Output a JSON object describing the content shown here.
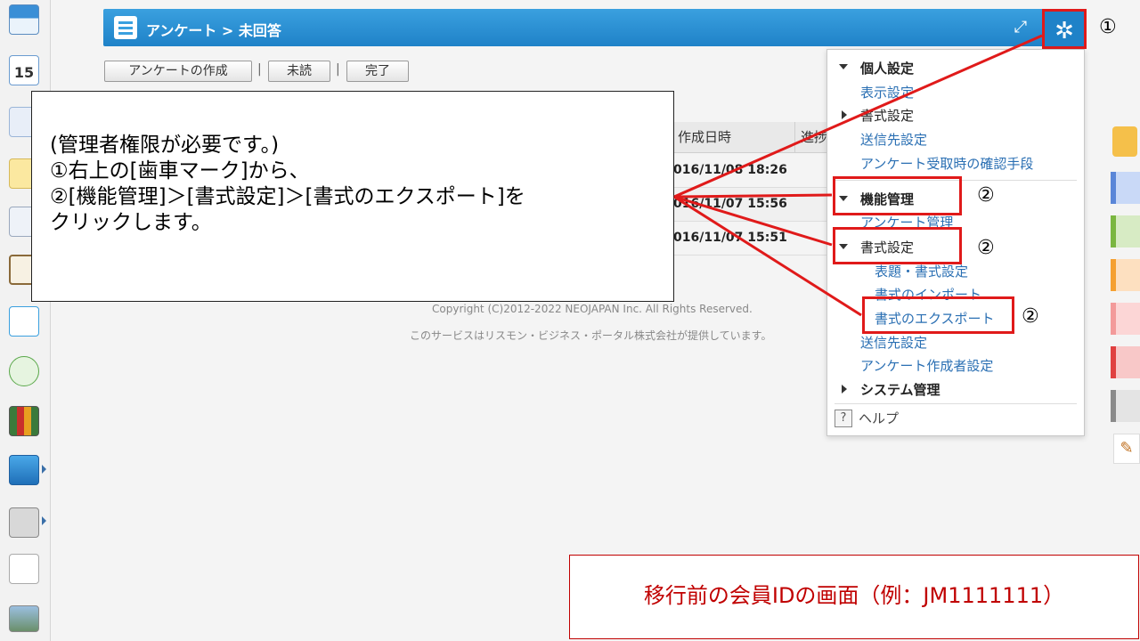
{
  "header": {
    "title": "アンケート > 未回答",
    "expand_icon": "expand-icon",
    "settings_icon": "gear-icon"
  },
  "toolbar": {
    "create_label": "アンケートの作成",
    "unread_label": "未読",
    "done_label": "完了",
    "separator": "|"
  },
  "table": {
    "columns": [
      "作成日時",
      "進捗"
    ],
    "rows": [
      "016/11/08 18:26",
      "016/11/07 15:56",
      "016/11/07 15:51"
    ]
  },
  "instruction": {
    "line1": "(管理者権限が必要です。)",
    "line2": "①右上の[歯車マーク]から、",
    "line3": "②[機能管理]＞[書式設定]＞[書式のエクスポート]を",
    "line4": "クリックします。"
  },
  "footer": {
    "copyright": "Copyright (C)2012-2022 NEOJAPAN Inc. All Rights Reserved.",
    "provider": "このサービスはリスモン・ビジネス・ポータル株式会社が提供しています。"
  },
  "menu": {
    "personal": "個人設定",
    "display": "表示設定",
    "format": "書式設定",
    "send_dest": "送信先設定",
    "receipt": "アンケート受取時の確認手段",
    "function_mgmt": "機能管理",
    "survey_mgmt": "アンケート管理",
    "format_settings": "書式設定",
    "title_format": "表題・書式設定",
    "format_import": "書式のインポート",
    "format_export": "書式のエクスポート",
    "send_dest2": "送信先設定",
    "creator": "アンケート作成者設定",
    "system": "システム管理",
    "help": "ヘルプ",
    "help_mark": "?"
  },
  "markers": {
    "one": "①",
    "two": "②"
  },
  "caption": "移行前の会員IDの画面（例：JM1111111）",
  "colors": {
    "accent": "#1f82c8",
    "highlight": "#e01a1a",
    "link": "#2a6fb3",
    "caption_text": "#c00000"
  }
}
